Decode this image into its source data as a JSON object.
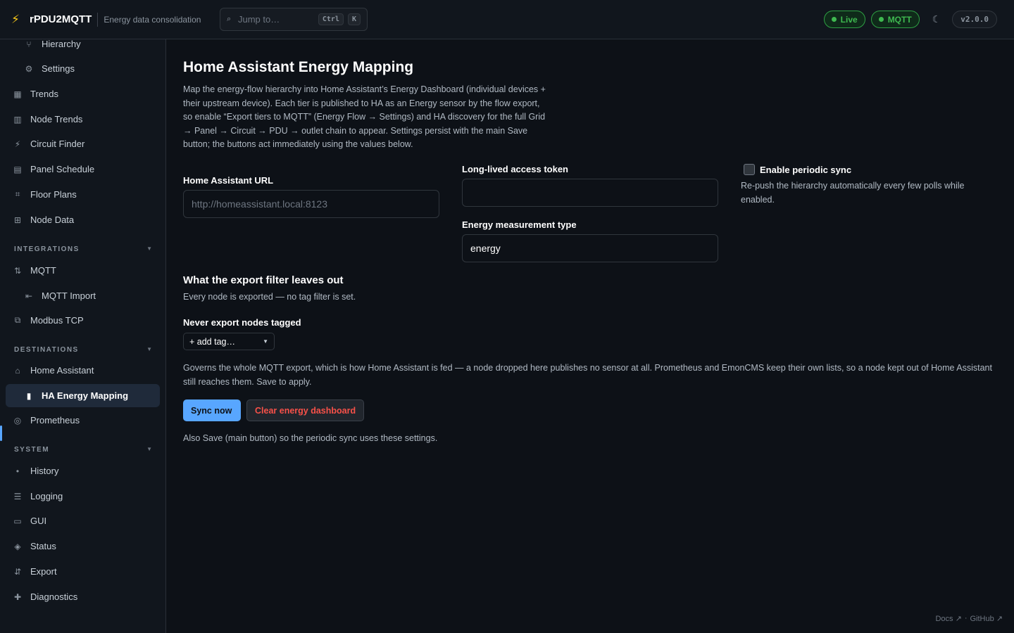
{
  "header": {
    "app_name": "rPDU2MQTT",
    "subtitle": "Energy data consolidation",
    "jump_placeholder": "Jump to…",
    "kbd_ctrl": "Ctrl",
    "kbd_k": "K",
    "status_live": "Live",
    "status_mqtt": "MQTT",
    "version": "v2.0.0",
    "status_color": "#3fb950",
    "accent_color": "#58a6ff"
  },
  "sidebar": {
    "items": [
      {
        "label": "Hierarchy",
        "icon": "hierarchy-icon",
        "glyph": "⑂"
      },
      {
        "label": "Settings",
        "icon": "gear-icon",
        "glyph": "⚙"
      },
      {
        "label": "Trends",
        "icon": "bar-chart-icon",
        "glyph": "▦"
      },
      {
        "label": "Node Trends",
        "icon": "node-chart-icon",
        "glyph": "▥"
      },
      {
        "label": "Circuit Finder",
        "icon": "plug-icon",
        "glyph": "⚡"
      },
      {
        "label": "Panel Schedule",
        "icon": "folder-icon",
        "glyph": "▤"
      },
      {
        "label": "Floor Plans",
        "icon": "grid-icon",
        "glyph": "⌗"
      },
      {
        "label": "Node Data",
        "icon": "table-icon",
        "glyph": "⊞"
      },
      {
        "label": "MQTT",
        "icon": "transfer-icon",
        "glyph": "⇅"
      },
      {
        "label": "MQTT Import",
        "icon": "import-icon",
        "glyph": "⇤"
      },
      {
        "label": "Modbus TCP",
        "icon": "copy-icon",
        "glyph": "⧉"
      },
      {
        "label": "Home Assistant",
        "icon": "home-icon",
        "glyph": "⌂"
      },
      {
        "label": "HA Energy Mapping",
        "icon": "battery-icon",
        "glyph": "▮"
      },
      {
        "label": "Prometheus",
        "icon": "target-icon",
        "glyph": "◎"
      },
      {
        "label": "History",
        "icon": "dot-icon",
        "glyph": "•"
      },
      {
        "label": "Logging",
        "icon": "list-icon",
        "glyph": "☰"
      },
      {
        "label": "GUI",
        "icon": "monitor-icon",
        "glyph": "▭"
      },
      {
        "label": "Status",
        "icon": "status-icon",
        "glyph": "◈"
      },
      {
        "label": "Export",
        "icon": "export-icon",
        "glyph": "⇵"
      },
      {
        "label": "Diagnostics",
        "icon": "plus-icon",
        "glyph": "✚"
      }
    ],
    "sections": {
      "integrations": "INTEGRATIONS",
      "destinations": "DESTINATIONS",
      "system": "SYSTEM"
    }
  },
  "main": {
    "title": "Home Assistant Energy Mapping",
    "description": "Map the energy-flow hierarchy into Home Assistant’s Energy Dashboard (individual devices + their upstream device). Each tier is published to HA as an Energy sensor by the flow export, so enable “Export tiers to MQTT” (Energy Flow → Settings) and HA discovery for the full Grid → Panel → Circuit → PDU → outlet chain to appear. Settings persist with the main Save button; the buttons act immediately using the values below.",
    "ha_url_label": "Home Assistant URL",
    "ha_url_placeholder": "http://homeassistant.local:8123",
    "ha_url_value": "",
    "token_label": "Long-lived access token",
    "token_value": "",
    "measurement_label": "Energy measurement type",
    "measurement_value": "energy",
    "periodic_label": "Enable periodic sync",
    "periodic_help": "Re-push the hierarchy automatically every few polls while enabled.",
    "filter_title": "What the export filter leaves out",
    "filter_note": "Every node is exported — no tag filter is set.",
    "never_label": "Never export nodes tagged",
    "add_tag": "+ add tag…",
    "governs": "Governs the whole MQTT export, which is how Home Assistant is fed — a node dropped here publishes no sensor at all. Prometheus and EmonCMS keep their own lists, so a node kept out of Home Assistant still reaches them. Save to apply.",
    "sync_button": "Sync now",
    "clear_button": "Clear energy dashboard",
    "also_note": "Also Save (main button) so the periodic sync uses these settings.",
    "danger_color": "#f85149"
  },
  "footer": {
    "docs": "Docs ↗",
    "sep": "·",
    "github": "GitHub ↗"
  }
}
